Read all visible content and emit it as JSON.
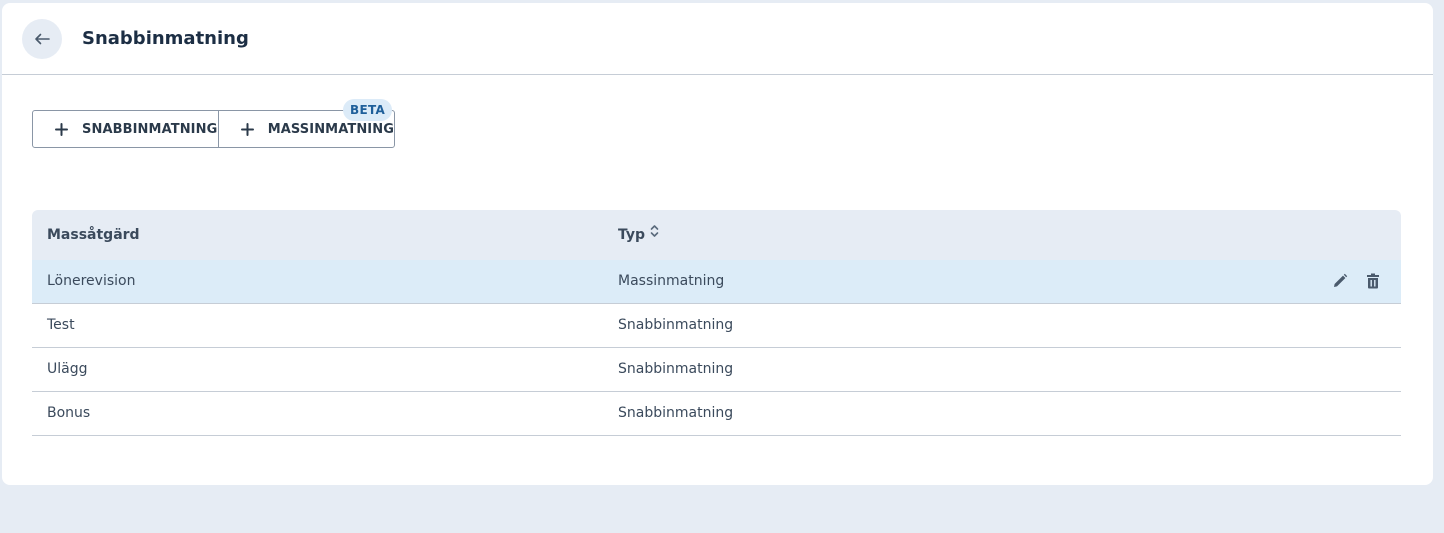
{
  "header": {
    "title": "Snabbinmatning",
    "back_icon": "arrow-left-icon"
  },
  "actions": {
    "quick_entry_label": "SNABBINMATNING",
    "mass_entry_label": "MASSINMATNING",
    "beta_badge": "BETA"
  },
  "table": {
    "columns": [
      "Massåtgärd",
      "Typ"
    ],
    "sorted_column": "Typ",
    "rows": [
      {
        "name": "Lönerevision",
        "type": "Massinmatning",
        "selected": true
      },
      {
        "name": "Test",
        "type": "Snabbinmatning",
        "selected": false
      },
      {
        "name": "Ulägg",
        "type": "Snabbinmatning",
        "selected": false
      },
      {
        "name": "Bonus",
        "type": "Snabbinmatning",
        "selected": false
      }
    ],
    "row_action_icons": [
      "pencil-icon",
      "trash-icon"
    ]
  },
  "colors": {
    "page_bg": "#e6ecf4",
    "selected_row": "#dcecf8",
    "beta_bg": "#dcebf8",
    "beta_text": "#1f5f9a",
    "title_text": "#1c2e44"
  }
}
